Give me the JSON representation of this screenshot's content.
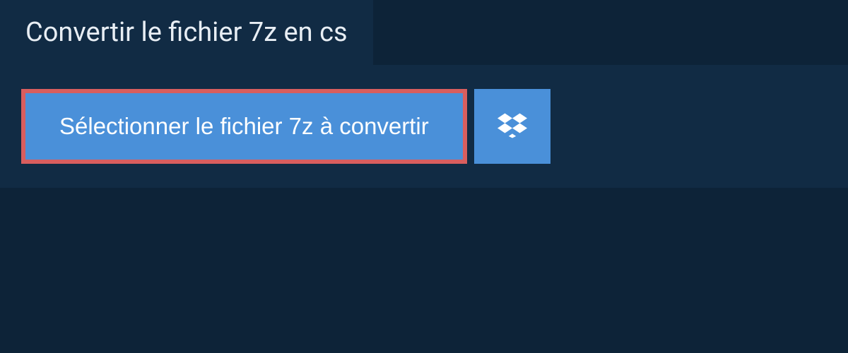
{
  "tab": {
    "title": "Convertir le fichier 7z en cs"
  },
  "actions": {
    "select_file_label": "Sélectionner le fichier 7z à convertir"
  }
}
